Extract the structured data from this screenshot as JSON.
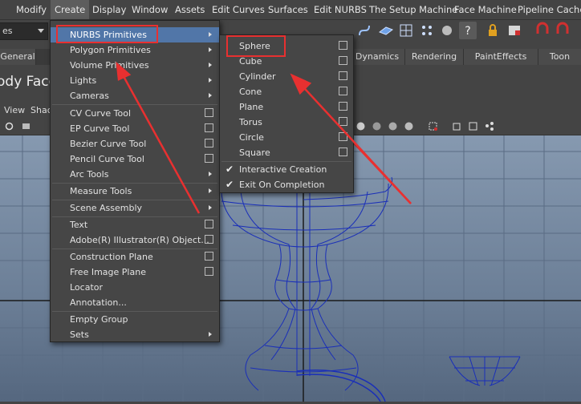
{
  "menubar": {
    "items": [
      "Modify",
      "Create",
      "Display",
      "Window",
      "Assets",
      "Edit Curves",
      "Surfaces",
      "Edit NURBS",
      "The Setup Machine",
      "Face Machine",
      "Pipeline Cache"
    ]
  },
  "toolbar": {
    "mode_value": "es"
  },
  "shelf_tabs": [
    "General",
    "Dynamics",
    "Rendering",
    "PaintEffects",
    "Toon"
  ],
  "shelf": {
    "title": "ody Face"
  },
  "panel_menu": [
    "View",
    "Shac"
  ],
  "create_menu": {
    "items": [
      {
        "label": "NURBS Primitives",
        "submenu": true
      },
      {
        "label": "Polygon Primitives",
        "submenu": true
      },
      {
        "label": "Volume Primitives",
        "submenu": true
      },
      {
        "label": "Lights",
        "submenu": true
      },
      {
        "label": "Cameras",
        "submenu": true
      },
      {
        "label": "CV Curve Tool",
        "option_box": true
      },
      {
        "label": "EP Curve Tool",
        "option_box": true
      },
      {
        "label": "Bezier Curve Tool",
        "option_box": true
      },
      {
        "label": "Pencil Curve Tool",
        "option_box": true
      },
      {
        "label": "Arc Tools",
        "submenu": true
      },
      {
        "label": "Measure Tools",
        "submenu": true
      },
      {
        "label": "Scene Assembly",
        "submenu": true
      },
      {
        "label": "Text",
        "option_box": true
      },
      {
        "label": "Adobe(R) Illustrator(R) Object...",
        "option_box": true
      },
      {
        "label": "Construction Plane",
        "option_box": true
      },
      {
        "label": "Free Image Plane",
        "option_box": true
      },
      {
        "label": "Locator"
      },
      {
        "label": "Annotation..."
      },
      {
        "label": "Empty Group"
      },
      {
        "label": "Sets",
        "submenu": true
      }
    ]
  },
  "nurbs_submenu": {
    "items": [
      {
        "label": "Sphere",
        "option_box": true
      },
      {
        "label": "Cube",
        "option_box": true
      },
      {
        "label": "Cylinder",
        "option_box": true
      },
      {
        "label": "Cone",
        "option_box": true
      },
      {
        "label": "Plane",
        "option_box": true
      },
      {
        "label": "Torus",
        "option_box": true
      },
      {
        "label": "Circle",
        "option_box": true
      },
      {
        "label": "Square",
        "option_box": true
      },
      {
        "label": "Interactive Creation",
        "checked": true
      },
      {
        "label": "Exit On Completion",
        "checked": true
      }
    ]
  },
  "colors": {
    "menu_bg": "#464646",
    "highlight": "#5176a8",
    "annotation_red": "#e83030",
    "wire_blue": "#1a2fb8"
  }
}
